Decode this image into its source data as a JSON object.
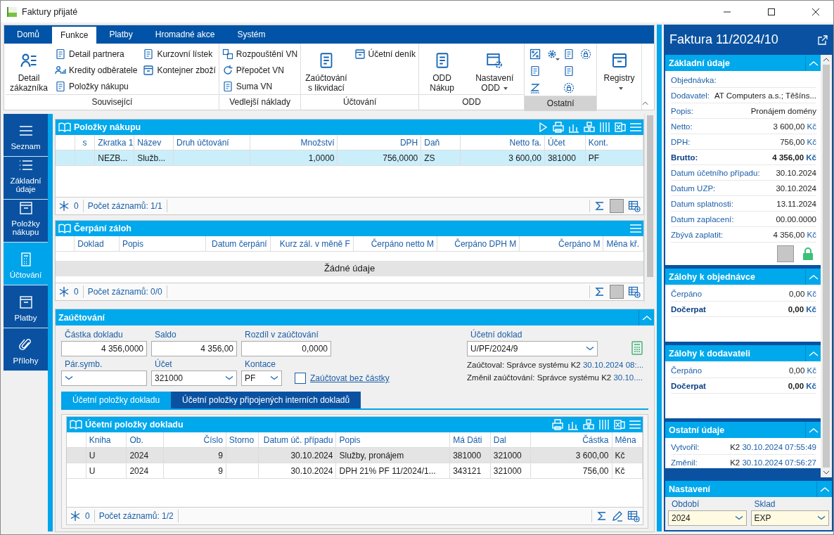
{
  "window": {
    "title": "Faktury přijaté"
  },
  "ribbon": {
    "tabs": [
      {
        "label": "Domů",
        "selected": false
      },
      {
        "label": "Funkce",
        "selected": true
      },
      {
        "label": "Platby",
        "selected": false
      },
      {
        "label": "Hromadné akce",
        "selected": false
      },
      {
        "label": "Systém",
        "selected": false
      }
    ],
    "groups": [
      {
        "label": "Související",
        "highlighted": false,
        "items": [
          {
            "label": "Detail zákazníka",
            "kind": "large",
            "dropdown": false
          },
          {
            "label": "Detail partnera",
            "kind": "small",
            "dropdown": false
          },
          {
            "label": "Kredity odběratele",
            "kind": "small",
            "dropdown": false
          },
          {
            "label": "Položky nákupu",
            "kind": "small",
            "dropdown": false
          },
          {
            "label": "Kurzovní lístek",
            "kind": "small",
            "dropdown": false
          },
          {
            "label": "Kontejner zboží",
            "kind": "small",
            "dropdown": false
          }
        ]
      },
      {
        "label": "Vedlejší náklady",
        "highlighted": false,
        "items": [
          {
            "label": "Rozpouštění VN",
            "kind": "small",
            "dropdown": false
          },
          {
            "label": "Přepočet VN",
            "kind": "small",
            "dropdown": false
          },
          {
            "label": "Suma VN",
            "kind": "small",
            "dropdown": false
          }
        ]
      },
      {
        "label": "Účtování",
        "highlighted": false,
        "items": [
          {
            "label": "Zaúčtování s likvidací",
            "kind": "large",
            "dropdown": false
          },
          {
            "label": "Účetní deník",
            "kind": "small",
            "dropdown": false
          }
        ]
      },
      {
        "label": "ODD",
        "highlighted": false,
        "items": [
          {
            "label": "ODD Nákup",
            "kind": "large",
            "dropdown": false
          },
          {
            "label": "Nastavení ODD",
            "kind": "large",
            "dropdown": true
          }
        ]
      },
      {
        "label": "Ostatní",
        "highlighted": true,
        "items": [
          {
            "kind": "icon",
            "dropdown": false
          },
          {
            "kind": "icon",
            "dropdown": true
          },
          {
            "kind": "icon",
            "dropdown": false
          },
          {
            "kind": "icon",
            "dropdown": false
          },
          {
            "kind": "icon",
            "dropdown": false
          },
          {
            "kind": "icon",
            "dropdown": false
          },
          {
            "kind": "icon",
            "dropdown": false
          },
          {
            "kind": "icon",
            "dropdown": false
          }
        ]
      },
      {
        "items": [
          {
            "label": "Registry",
            "kind": "large",
            "dropdown": true
          }
        ]
      }
    ]
  },
  "nav": [
    {
      "label": "Seznam",
      "selected": false
    },
    {
      "label": "Základní údaje",
      "selected": false
    },
    {
      "label": "Položky nákupu",
      "selected": false
    },
    {
      "label": "Účtování",
      "selected": true
    },
    {
      "label": "Platby",
      "selected": false
    },
    {
      "label": "Přílohy",
      "selected": false
    }
  ],
  "purchase_items": {
    "title": "Položky nákupu",
    "columns": [
      {
        "label": "s",
        "kind": "center"
      },
      {
        "label": "Zkratka 1",
        "kind": "text"
      },
      {
        "label": "Název",
        "kind": "text"
      },
      {
        "label": "Druh účtování",
        "kind": "text"
      },
      {
        "label": "Množství",
        "kind": "number"
      },
      {
        "label": "DPH",
        "kind": "number"
      },
      {
        "label": "Daň",
        "kind": "text"
      },
      {
        "label": "Netto fa.",
        "kind": "number"
      },
      {
        "label": "Účet",
        "kind": "text"
      },
      {
        "label": "Kont.",
        "kind": "text"
      }
    ],
    "rows": [
      {
        "selected": true,
        "cells": [
          null,
          "NEZB...",
          "Služb...",
          null,
          "1,0000",
          "756,0000",
          "ZS",
          "3 600,00",
          "381000",
          "PF"
        ]
      }
    ],
    "filter_count": "0",
    "record_count": "Počet záznamů: 1/1"
  },
  "advances": {
    "title": "Čerpání záloh",
    "columns": [
      {
        "label": "Doklad",
        "kind": "text"
      },
      {
        "label": "Popis",
        "kind": "text"
      },
      {
        "label": "Datum čerpání",
        "kind": "number"
      },
      {
        "label": "Kurz zál. v měně F",
        "kind": "number"
      },
      {
        "label": "Čerpáno netto M",
        "kind": "number"
      },
      {
        "label": "Čerpáno DPH M",
        "kind": "number"
      },
      {
        "label": "Čerpáno M",
        "kind": "number"
      },
      {
        "label": "Měna kř.",
        "kind": "text"
      }
    ],
    "empty_text": "Žádné údaje",
    "filter_count": "0",
    "record_count": "Počet záznamů: 0/0"
  },
  "posting": {
    "title": "Zaúčtování",
    "expanded": true,
    "fields": [
      {
        "label": "Částka dokladu",
        "value": "4 356,0000",
        "kind": "number"
      },
      {
        "label": "Saldo",
        "value": "4 356,00",
        "kind": "number"
      },
      {
        "label": "Rozdíl v zaúčtování",
        "value": "0,0000",
        "kind": "number"
      },
      {
        "label": "Pár.symb.",
        "kind": "dropdown"
      },
      {
        "label": "Účet",
        "value": "321000",
        "kind": "dropdown"
      },
      {
        "label": "Kontace",
        "value": "PF",
        "kind": "dropdown"
      }
    ],
    "no_amount_checkbox": {
      "label": "Zaúčtovat bez částky",
      "checked": false
    },
    "document": {
      "label": "Účetní doklad",
      "value": "U/PF/2024/9"
    },
    "audit": [
      {
        "label": "Zaúčtoval:",
        "user": "Správce systému K2",
        "time": "30.10.2024 08:..."
      },
      {
        "label": "Změnil zaúčtování:",
        "user": "Správce systému K2",
        "time": "30.10...."
      }
    ],
    "tabs": [
      {
        "label": "Účetní položky dokladu",
        "selected": true
      },
      {
        "label": "Účetní položky připojených interních dokladů",
        "selected": false
      }
    ],
    "entries": {
      "title": "Účetní položky dokladu",
      "columns": [
        {
          "label": "Kniha",
          "kind": "text"
        },
        {
          "label": "Ob.",
          "kind": "text"
        },
        {
          "label": "Číslo",
          "kind": "number"
        },
        {
          "label": "Storno",
          "kind": "text"
        },
        {
          "label": "Datum úč. případu",
          "kind": "number"
        },
        {
          "label": "Popis",
          "kind": "text"
        },
        {
          "label": "Má Dáti",
          "kind": "text"
        },
        {
          "label": "Dal",
          "kind": "text"
        },
        {
          "label": "Částka",
          "kind": "number"
        },
        {
          "label": "Měna",
          "kind": "text"
        }
      ],
      "rows": [
        {
          "selected": true,
          "cells": [
            "U",
            "2024",
            "9",
            null,
            "30.10.2024",
            "Služby, pronájem",
            "381000",
            "321000",
            "3 600,00",
            "Kč"
          ]
        },
        {
          "selected": false,
          "cells": [
            "U",
            "2024",
            "9",
            null,
            "30.10.2024",
            "DPH 21% PF 11/2024/1...",
            "343121",
            "321000",
            "756,00",
            "Kč"
          ]
        }
      ],
      "filter_count": "0",
      "record_count": "Počet záznamů: 1/2"
    }
  },
  "detail": {
    "title": "Faktura 11/2024/10",
    "sections": [
      {
        "title": "Základní údaje",
        "expanded": true,
        "rows": [
          {
            "label": "Objednávka:",
            "kind": "plain"
          },
          {
            "label": "Dodavatel:",
            "value": "AT Computers a.s.; Těšíns...",
            "kind": "plain"
          },
          {
            "label": "Popis:",
            "value": "Pronájem domény",
            "kind": "plain"
          },
          {
            "label": "Netto:",
            "value": "3 600,00",
            "unit": "Kč",
            "kind": "plain"
          },
          {
            "label": "DPH:",
            "value": "756,00",
            "unit": "Kč",
            "kind": "plain"
          },
          {
            "label": "Brutto:",
            "value": "4 356,00",
            "unit": "Kč",
            "kind": "total"
          },
          {
            "label": "Datum účetního případu:",
            "value": "30.10.2024",
            "kind": "plain"
          },
          {
            "label": "Datum UZP:",
            "value": "30.10.2024",
            "kind": "plain"
          },
          {
            "label": "Datum splatnosti:",
            "value": "13.11.2024",
            "kind": "plain"
          },
          {
            "label": "Datum zaplacení:",
            "value": "00.00.0000",
            "kind": "plain"
          },
          {
            "label": "Zbývá zaplatit:",
            "value": "4 356,00",
            "unit": "Kč",
            "kind": "plain"
          }
        ]
      },
      {
        "title": "Zálohy k objednávce",
        "expanded": true,
        "rows": [
          {
            "label": "Čerpáno",
            "value": "0,00",
            "unit": "Kč",
            "kind": "plain"
          },
          {
            "label": "Dočerpat",
            "value": "0,00",
            "unit": "Kč",
            "kind": "total"
          }
        ]
      },
      {
        "title": "Zálohy k dodavateli",
        "expanded": true,
        "rows": [
          {
            "label": "Čerpáno",
            "value": "0,00",
            "unit": "Kč",
            "kind": "plain"
          },
          {
            "label": "Dočerpat",
            "value": "0,00",
            "unit": "Kč",
            "kind": "total"
          }
        ]
      },
      {
        "title": "Ostatní údaje",
        "expanded": true,
        "rows": [
          {
            "label": "Vytvořil:",
            "value": "K2",
            "time": "30.10.2024 07:55:49",
            "kind": "plain"
          },
          {
            "label": "Změnil:",
            "value": "K2",
            "time": "30.10.2024 07:56:27",
            "kind": "plain"
          }
        ]
      }
    ],
    "settings": {
      "title": "Nastavení",
      "expanded": true,
      "fields": [
        {
          "label": "Období",
          "value": "2024"
        },
        {
          "label": "Sklad",
          "value": "EXP"
        }
      ]
    }
  }
}
